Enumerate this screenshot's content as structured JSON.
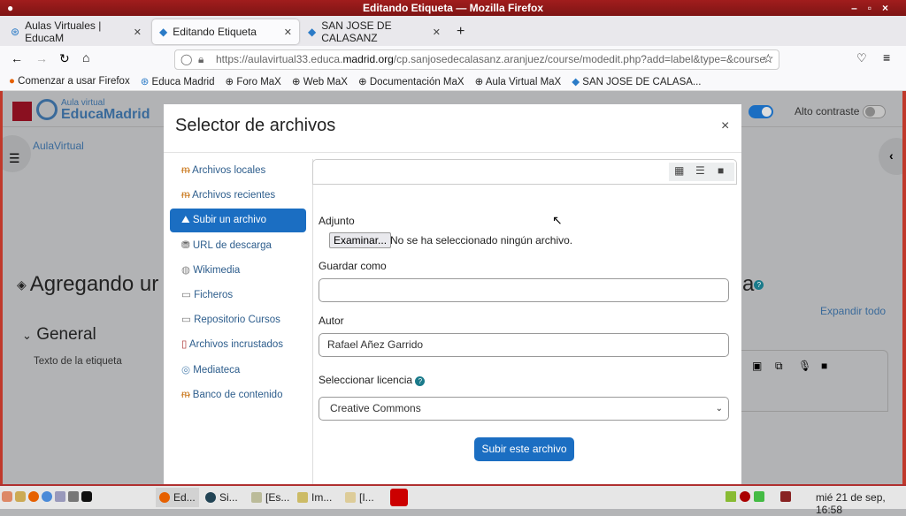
{
  "window": {
    "title": "Editando Etiqueta — Mozilla Firefox"
  },
  "tabs": [
    {
      "label": "Aulas Virtuales | EducaM"
    },
    {
      "label": "Editando Etiqueta"
    },
    {
      "label": "SAN JOSE DE CALASANZ"
    }
  ],
  "url": {
    "prefix": "https://aulavirtual33.educa.",
    "domain": "madrid.org",
    "path": "/cp.sanjosedecalasanz.aranjuez/course/modedit.php?add=label&type=&course"
  },
  "bookmarks": [
    "Comenzar a usar Firefox",
    "Educa Madrid",
    "Foro MaX",
    "Web MaX",
    "Documentación MaX",
    "Aula Virtual MaX",
    "SAN JOSE DE CALASA..."
  ],
  "background": {
    "logo_small": "Aula virtual",
    "logo_big": "EducaMadrid",
    "breadcrumb": "AulaVirtual",
    "heading": "Agregando ur",
    "heading_end": "a",
    "section": "General",
    "field_label": "Texto de la etiqueta",
    "high_contrast": "Alto contraste",
    "expand_all": "Expandir todo"
  },
  "modal": {
    "title": "Selector de archivos",
    "close": "×",
    "repositories": [
      "Archivos locales",
      "Archivos recientes",
      "Subir un archivo",
      "URL de descarga",
      "Wikimedia",
      "Ficheros",
      "Repositorio Cursos",
      "Archivos incrustados",
      "Mediateca",
      "Banco de contenido"
    ],
    "form": {
      "attachment_label": "Adjunto",
      "browse_button": "Examinar...",
      "no_file": "No se ha seleccionado ningún archivo.",
      "save_as_label": "Guardar como",
      "save_as_value": "",
      "author_label": "Autor",
      "author_value": "Rafael Añez Garrido",
      "license_label": "Seleccionar licencia",
      "license_value": "Creative Commons",
      "submit": "Subir este archivo"
    }
  },
  "taskbar": {
    "tasks": [
      "Ed...",
      "Si...",
      "[Es...",
      "Im...",
      "[I..."
    ],
    "clock": "mié 21 de sep, 16:58"
  },
  "colors": {
    "accent": "#1b6ec2",
    "titlebar": "#8b1818"
  }
}
